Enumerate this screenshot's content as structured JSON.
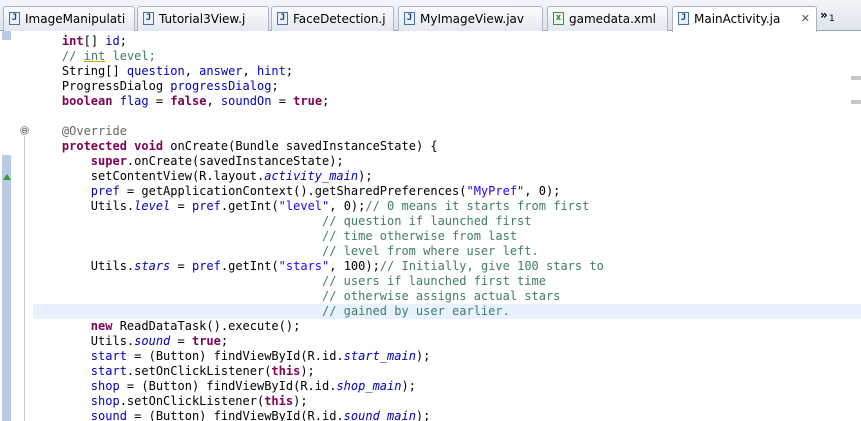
{
  "tabs": [
    {
      "label": "ImageManipulati",
      "icon": "java-file-icon",
      "glyph": "J"
    },
    {
      "label": "Tutorial3View.j",
      "icon": "java-file-icon",
      "glyph": "J"
    },
    {
      "label": "FaceDetection.j",
      "icon": "java-file-icon",
      "glyph": "J"
    },
    {
      "label": "MyImageView.jav",
      "icon": "java-file-icon",
      "glyph": "J"
    },
    {
      "label": "gamedata.xml",
      "icon": "xml-file-icon",
      "glyph": "x"
    },
    {
      "label": "MainActivity.ja",
      "icon": "java-file-icon",
      "glyph": "J",
      "active": true,
      "close": "✕"
    }
  ],
  "overflow": {
    "chevron": "»",
    "count": "1"
  },
  "code_lines": [
    [
      {
        "t": "    "
      },
      {
        "t": "int",
        "c": "kw"
      },
      {
        "t": "[] "
      },
      {
        "t": "id",
        "c": "fl"
      },
      {
        "t": ";"
      }
    ],
    [
      {
        "t": "    "
      },
      {
        "t": "// ",
        "c": "cm"
      },
      {
        "t": "int",
        "c": "cm sq"
      },
      {
        "t": " level;",
        "c": "cm"
      }
    ],
    [
      {
        "t": "    String[] "
      },
      {
        "t": "question",
        "c": "fl"
      },
      {
        "t": ", "
      },
      {
        "t": "answer",
        "c": "fl"
      },
      {
        "t": ", "
      },
      {
        "t": "hint",
        "c": "fl"
      },
      {
        "t": ";"
      }
    ],
    [
      {
        "t": "    ProgressDialog "
      },
      {
        "t": "progressDialog",
        "c": "fl"
      },
      {
        "t": ";"
      }
    ],
    [
      {
        "t": "    "
      },
      {
        "t": "boolean",
        "c": "kw"
      },
      {
        "t": " "
      },
      {
        "t": "flag",
        "c": "fl"
      },
      {
        "t": " = "
      },
      {
        "t": "false",
        "c": "kw"
      },
      {
        "t": ", "
      },
      {
        "t": "soundOn",
        "c": "fl"
      },
      {
        "t": " = "
      },
      {
        "t": "true",
        "c": "kw"
      },
      {
        "t": ";"
      }
    ],
    [
      {
        "t": ""
      }
    ],
    [
      {
        "t": "    "
      },
      {
        "t": "@Override",
        "c": "an"
      }
    ],
    [
      {
        "t": "    "
      },
      {
        "t": "protected",
        "c": "kw"
      },
      {
        "t": " "
      },
      {
        "t": "void",
        "c": "kw"
      },
      {
        "t": " onCreate(Bundle savedInstanceState) {"
      }
    ],
    [
      {
        "t": "        "
      },
      {
        "t": "super",
        "c": "kw"
      },
      {
        "t": ".onCreate(savedInstanceState);"
      }
    ],
    [
      {
        "t": "        setContentView(R.layout."
      },
      {
        "t": "activity_main",
        "c": "fi"
      },
      {
        "t": ");"
      }
    ],
    [
      {
        "t": "        "
      },
      {
        "t": "pref",
        "c": "fl"
      },
      {
        "t": " = getApplicationContext().getSharedPreferences("
      },
      {
        "t": "\"MyPref\"",
        "c": "st"
      },
      {
        "t": ", 0);"
      }
    ],
    [
      {
        "t": "        Utils."
      },
      {
        "t": "level",
        "c": "fi"
      },
      {
        "t": " = "
      },
      {
        "t": "pref",
        "c": "fl"
      },
      {
        "t": ".getInt("
      },
      {
        "t": "\"level\"",
        "c": "st"
      },
      {
        "t": ", 0);"
      },
      {
        "t": "// 0 means it starts from first",
        "c": "cm"
      }
    ],
    [
      {
        "t": "                                        "
      },
      {
        "t": "// question if launched first",
        "c": "cm"
      }
    ],
    [
      {
        "t": "                                        "
      },
      {
        "t": "// time otherwise from last",
        "c": "cm"
      }
    ],
    [
      {
        "t": "                                        "
      },
      {
        "t": "// level from where user left.",
        "c": "cm"
      }
    ],
    [
      {
        "t": "        Utils."
      },
      {
        "t": "stars",
        "c": "fi"
      },
      {
        "t": " = "
      },
      {
        "t": "pref",
        "c": "fl"
      },
      {
        "t": ".getInt("
      },
      {
        "t": "\"stars\"",
        "c": "st"
      },
      {
        "t": ", 100);"
      },
      {
        "t": "// Initially, give 100 stars to",
        "c": "cm"
      }
    ],
    [
      {
        "t": "                                        "
      },
      {
        "t": "// users if launched first time",
        "c": "cm"
      }
    ],
    [
      {
        "t": "                                        "
      },
      {
        "t": "// otherwise assigns actual stars",
        "c": "cm"
      }
    ],
    [
      {
        "t": "                                        "
      },
      {
        "t": "// gained by user earlier.",
        "c": "cm"
      }
    ],
    [
      {
        "t": "        "
      },
      {
        "t": "new",
        "c": "kw"
      },
      {
        "t": " ReadDataTask().execute();"
      }
    ],
    [
      {
        "t": "        Utils."
      },
      {
        "t": "sound",
        "c": "fi"
      },
      {
        "t": " = "
      },
      {
        "t": "true",
        "c": "kw"
      },
      {
        "t": ";"
      }
    ],
    [
      {
        "t": "        "
      },
      {
        "t": "start",
        "c": "fl"
      },
      {
        "t": " = (Button) findViewById(R.id."
      },
      {
        "t": "start_main",
        "c": "fi"
      },
      {
        "t": ");"
      }
    ],
    [
      {
        "t": "        "
      },
      {
        "t": "start",
        "c": "fl"
      },
      {
        "t": ".setOnClickListener("
      },
      {
        "t": "this",
        "c": "kw"
      },
      {
        "t": ");"
      }
    ],
    [
      {
        "t": "        "
      },
      {
        "t": "shop",
        "c": "fl"
      },
      {
        "t": " = (Button) findViewById(R.id."
      },
      {
        "t": "shop_main",
        "c": "fi"
      },
      {
        "t": ");"
      }
    ],
    [
      {
        "t": "        "
      },
      {
        "t": "shop",
        "c": "fl"
      },
      {
        "t": ".setOnClickListener("
      },
      {
        "t": "this",
        "c": "kw"
      },
      {
        "t": ");"
      }
    ],
    [
      {
        "t": "        "
      },
      {
        "t": "sound",
        "c": "fl"
      },
      {
        "t": " = (Button) findViewById(R.id."
      },
      {
        "t": "sound_main",
        "c": "fi"
      },
      {
        "t": ");"
      }
    ]
  ],
  "current_line": 18,
  "fold_button": "⊖",
  "colors": {
    "keyword": "#7f0055",
    "comment": "#3f7f5f",
    "string": "#2a00ff",
    "annotation": "#646464",
    "field": "#0000c0",
    "current_line_bg": "#e8f2fe"
  }
}
